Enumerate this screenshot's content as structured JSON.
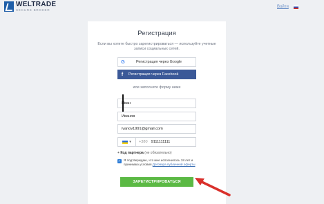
{
  "header": {
    "brand_name": "WELTRADE",
    "brand_tagline": "SECURE BROKER",
    "login_link": "Войти"
  },
  "form": {
    "title": "Регистрация",
    "subtitle": "Если вы хотите быстро зарегистрироваться — используйте учетные записи социальных сетей.",
    "google_button": "Регистрация через Google",
    "facebook_button": "Регистрация через Facebook",
    "or_text": "или заполните форму ниже",
    "first_name": "Иван",
    "last_name": "Иванов",
    "email": "ivanov1991@gmail.com",
    "phone_code": "+380",
    "phone_number": "9111111111",
    "partner_label": "Код партнера",
    "partner_optional": "(не обязательно)",
    "consent_text": "Я подтверждаю, что мне исполнилось 18 лет и принимаю условия",
    "consent_link": "Договора публичной оферты",
    "consent_checked": true,
    "submit_button": "ЗАРЕГИСТРИРОВАТЬСЯ"
  },
  "colors": {
    "brand_blue": "#1e5ea8",
    "facebook": "#3b5998",
    "submit_green": "#5bb944",
    "arrow_red": "#d9302b"
  }
}
